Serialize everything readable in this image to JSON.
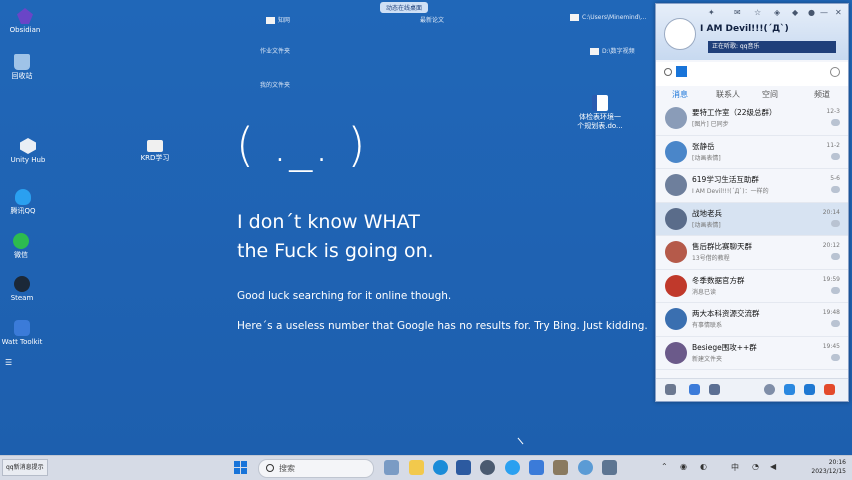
{
  "desktop": {
    "icons": [
      {
        "label": "Obsidian",
        "color": "#6a45c7"
      },
      {
        "label": "回收站",
        "color": "#9fc3e8"
      },
      {
        "label": "Unity Hub",
        "color": "#e9eef5"
      },
      {
        "label": "腾讯QQ",
        "color": "#2aa0f0"
      },
      {
        "label": "微信",
        "color": "#2dbb4f"
      },
      {
        "label": "Steam",
        "color": "#1b2838"
      },
      {
        "label": "Watt Toolkit",
        "color": "#3b7bd9"
      },
      {
        "label": "KRD学习",
        "color": "#f0f0f0"
      },
      {
        "label": "体检表环境一\n个规划表.do...",
        "color": "#2a5bb0"
      }
    ],
    "top_items": [
      {
        "label": "动态在线桌面"
      },
      {
        "label": "知网"
      },
      {
        "label": "作业文件夹"
      },
      {
        "label": "我的文件夹"
      },
      {
        "label": "最新论文"
      },
      {
        "label": "C:\\Users\\Minemind\\..."
      },
      {
        "label": "D:\\数字视频"
      }
    ]
  },
  "error_screen": {
    "face": "( ._. )",
    "line1": "I don´t know WHAT",
    "line2": "the Fuck is going on.",
    "line3": "Good luck searching for it online though.",
    "line4": "Here´s a useless number that Google has no results for. Try Bing. Just kidding."
  },
  "taskbar": {
    "left_badge": "qq新消息提示",
    "search_placeholder": "搜索",
    "tray_lang": "中",
    "clock_time": "20:16",
    "clock_date": "2023/12/15"
  },
  "chat_window": {
    "user_name": "I AM Devil!!!(´Д`)",
    "status_text": "正在听歌: qq音乐",
    "tabs": [
      "消息",
      "联系人",
      "空间",
      "频道"
    ],
    "conversations": [
      {
        "name": "要特工作室（22级总群）",
        "preview": "[图片] 已同步",
        "time": "12-3",
        "avatar_color": "#8a9cb8"
      },
      {
        "name": "张静岳",
        "preview": "[动画表情]",
        "time": "11-2",
        "avatar_color": "#4a86c9"
      },
      {
        "name": "619学习生活互助群",
        "preview": "I AM Devil!!!(´Д`)：一样的",
        "time": "5-6",
        "avatar_color": "#6e7f9c"
      },
      {
        "name": "战地老兵",
        "preview": "[动画表情]",
        "time": "20:14",
        "avatar_color": "#5a6c8a"
      },
      {
        "name": "售后群比赛聊天群",
        "preview": "13号借的教程",
        "time": "20:12",
        "avatar_color": "#b55a4a"
      },
      {
        "name": "冬季数据官方群",
        "preview": "消息已读",
        "time": "19:59",
        "avatar_color": "#c0392b"
      },
      {
        "name": "两大本科资源交流群",
        "preview": "有事情联系",
        "time": "19:48",
        "avatar_color": "#3a6fb0"
      },
      {
        "name": "Besiege围攻++群",
        "preview": "新建文件夹",
        "time": "19:45",
        "avatar_color": "#6b5a8a"
      }
    ]
  },
  "colors": {
    "desktop_bg": "#1e64b7",
    "accent": "#1874d9",
    "selected_row": "#d7e3f2"
  }
}
